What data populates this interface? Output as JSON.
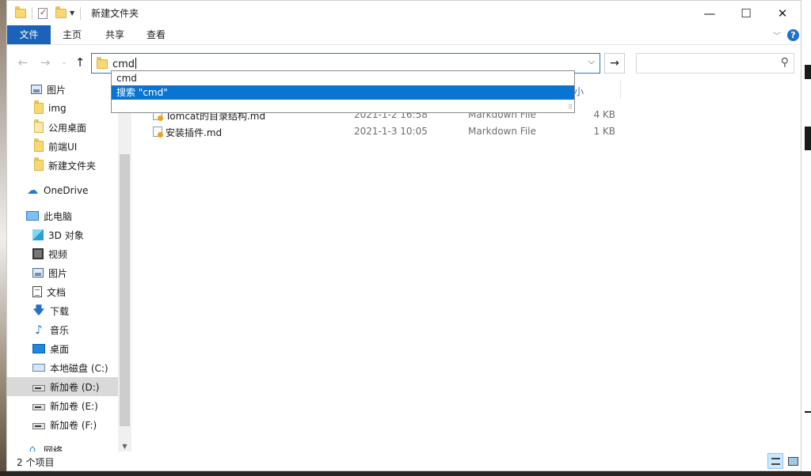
{
  "window": {
    "title": "新建文件夹"
  },
  "ribbon": {
    "tabs": [
      "文件",
      "主页",
      "共享",
      "查看"
    ]
  },
  "address": {
    "value": "cmd"
  },
  "autocomplete": {
    "items": [
      "cmd",
      "搜索 \"cmd\""
    ]
  },
  "sidebar": {
    "items": [
      "图片",
      "img",
      "公用桌面",
      "前端UI",
      "新建文件夹",
      "OneDrive",
      "此电脑",
      "3D 对象",
      "视频",
      "图片",
      "文档",
      "下载",
      "音乐",
      "桌面",
      "本地磁盘 (C:)",
      "新加卷 (D:)",
      "新加卷 (E:)",
      "新加卷 (F:)",
      "网络"
    ]
  },
  "files": {
    "header_fragment": "小",
    "rows": [
      {
        "name": "Tomcat的目录结构.md",
        "date": "2021-1-2 16:58",
        "type": "Markdown File",
        "size": "4 KB"
      },
      {
        "name": "安装插件.md",
        "date": "2021-1-3 10:05",
        "type": "Markdown File",
        "size": "1 KB"
      }
    ]
  },
  "status": {
    "count": "2 个项目"
  },
  "colors": {
    "accent": "#1a63b8",
    "selection": "#0a74d3"
  }
}
